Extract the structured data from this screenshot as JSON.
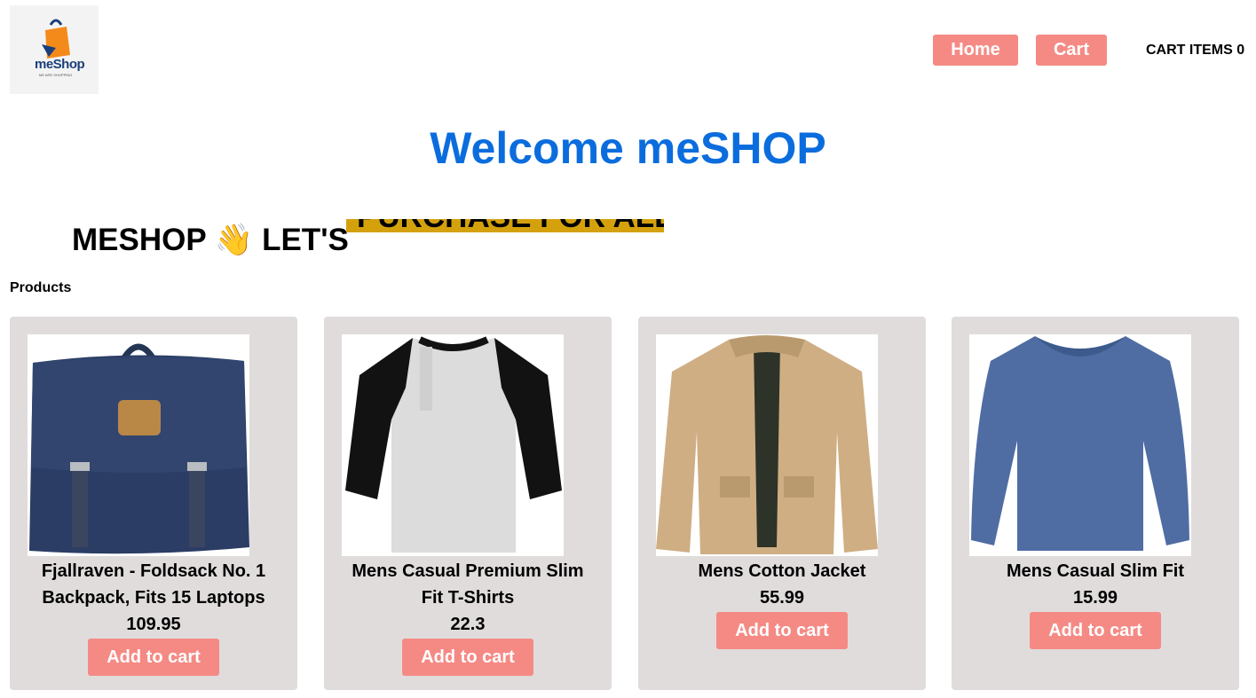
{
  "header": {
    "logo_text": "meShop",
    "logo_tagline": "ME ARE SHOPPING",
    "nav": {
      "home_label": "Home",
      "cart_label": "Cart"
    },
    "cart_items_label": "CART ITEMS 0"
  },
  "hero": {
    "welcome": "Welcome meSHOP",
    "tagline_left": "MESHOP 👋 LET'S",
    "tagline_highlight": "PURCHASE FOR ALL"
  },
  "products_heading": "Products",
  "products": [
    {
      "title": "Fjallraven - Foldsack No. 1 Backpack, Fits 15 Laptops",
      "price": "109.95",
      "button": "Add to cart",
      "image_icon": "backpack-image"
    },
    {
      "title": "Mens Casual Premium Slim Fit T-Shirts",
      "price": "22.3",
      "button": "Add to cart",
      "image_icon": "tshirt-image"
    },
    {
      "title": "Mens Cotton Jacket",
      "price": "55.99",
      "button": "Add to cart",
      "image_icon": "jacket-image"
    },
    {
      "title": "Mens Casual Slim Fit",
      "price": "15.99",
      "button": "Add to cart",
      "image_icon": "longsleeve-image"
    }
  ],
  "colors": {
    "accent_button": "#f58a85",
    "welcome_blue": "#0b6ddd",
    "highlight_gold": "#d4a10d",
    "card_bg": "#e0dcdc"
  }
}
